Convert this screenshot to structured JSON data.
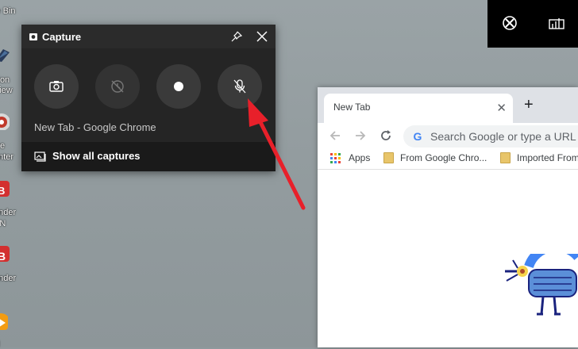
{
  "desktop": {
    "icons": [
      {
        "label_lines": [
          "le Bin"
        ],
        "icon": "recycle-bin-icon"
      },
      {
        "label_lines": [
          "sion",
          "View"
        ],
        "icon": "app-icon"
      },
      {
        "label_lines": [
          "ive",
          "enter"
        ],
        "icon": "drive-center-icon"
      },
      {
        "label_lines": [
          "ender",
          "PN"
        ],
        "icon": "bitdefender-vpn-icon"
      },
      {
        "label_lines": [
          "ender"
        ],
        "icon": "bitdefender-icon"
      },
      {
        "label_lines": [
          "H"
        ],
        "icon": "media-player-icon"
      }
    ]
  },
  "gamebar": {
    "xbox_icon": "xbox-icon",
    "performance_icon": "performance-widget-icon"
  },
  "capture_widget": {
    "title": "Capture",
    "source": "New Tab - Google Chrome",
    "show_all": "Show all captures",
    "buttons": [
      {
        "name": "screenshot",
        "icon": "camera-icon"
      },
      {
        "name": "record-last",
        "icon": "record-last-30s-icon"
      },
      {
        "name": "start-recording",
        "icon": "record-dot-icon"
      },
      {
        "name": "microphone",
        "icon": "mic-off-icon"
      }
    ]
  },
  "chrome": {
    "tab_title": "New Tab",
    "tab_close": "✕",
    "new_tab": "+",
    "omnibox_placeholder": "Search Google or type a URL",
    "bookmarks": [
      "Apps",
      "From Google Chro...",
      "Imported From"
    ]
  },
  "colors": {
    "annotation_arrow": "#e8202a",
    "capture_bg": "#1f1f1f",
    "accent_blue": "#4285f4"
  }
}
